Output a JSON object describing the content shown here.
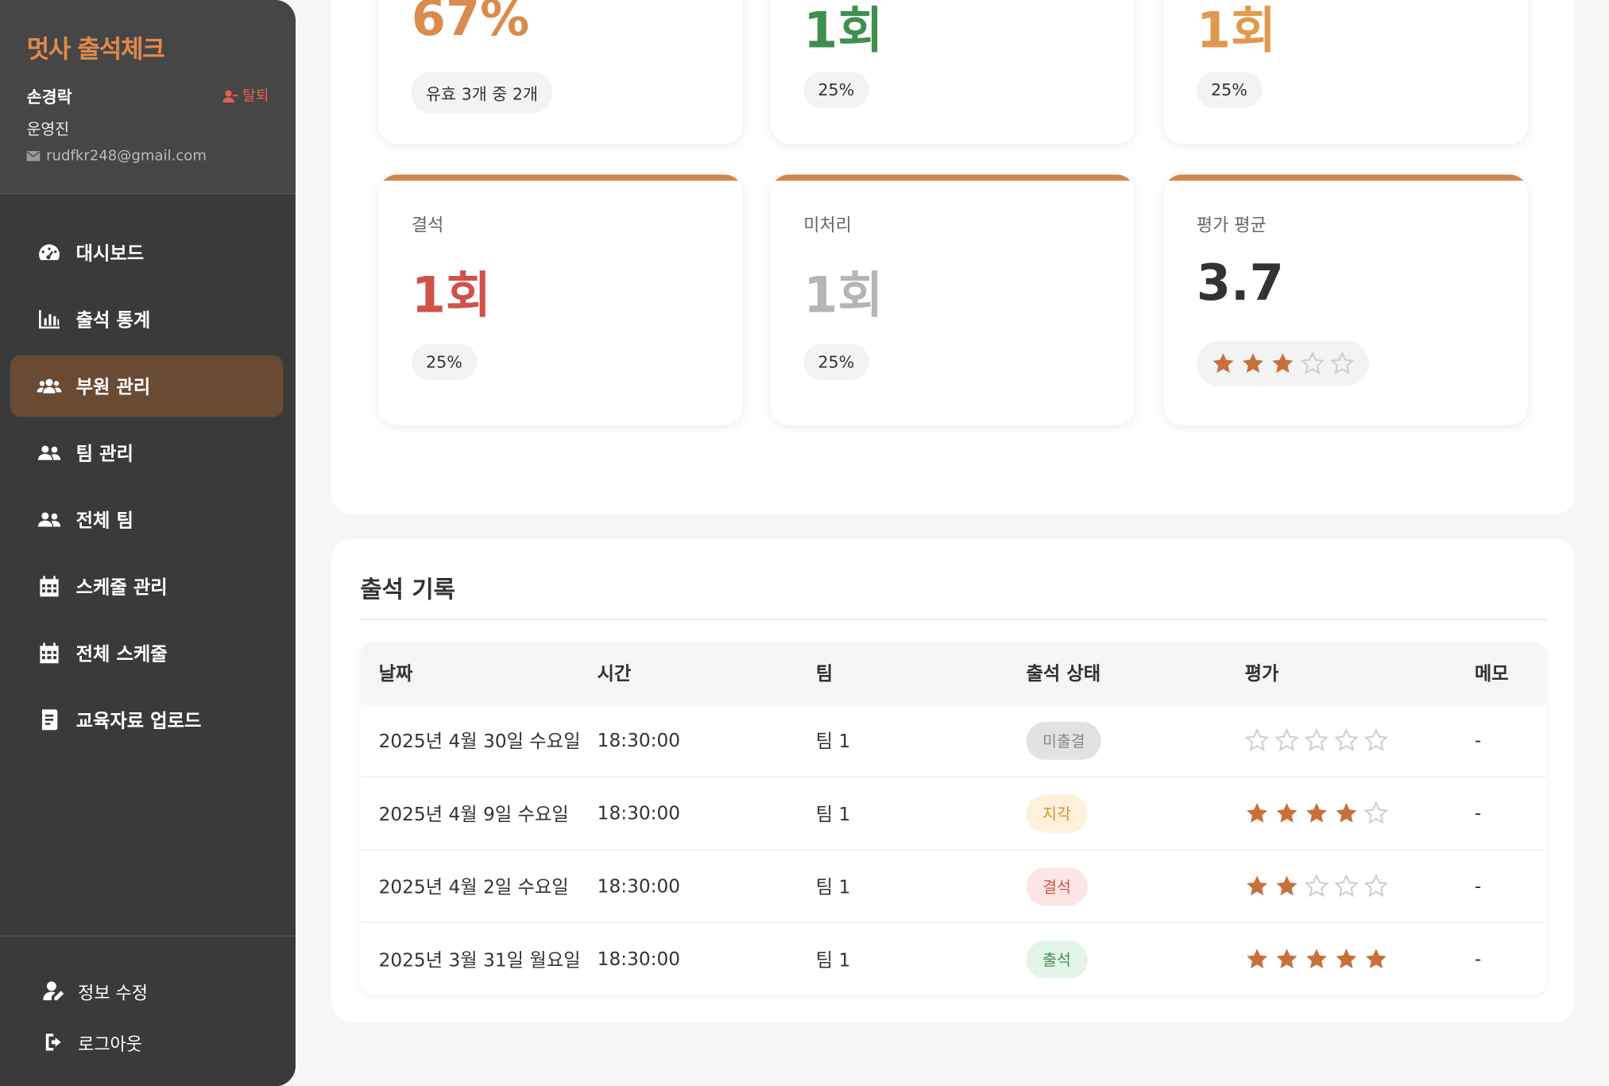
{
  "app": {
    "brand": "멋사 출석체크"
  },
  "user": {
    "name": "손경락",
    "leave": "탈퇴",
    "role": "운영진",
    "email": "rudfkr248@gmail.com"
  },
  "nav": [
    {
      "label": "대시보드",
      "icon": "dashboard-icon",
      "active": false
    },
    {
      "label": "출석 통계",
      "icon": "chart-bar-icon",
      "active": false
    },
    {
      "label": "부원 관리",
      "icon": "users-icon",
      "active": true
    },
    {
      "label": "팀 관리",
      "icon": "user-group-icon",
      "active": false
    },
    {
      "label": "전체 팀",
      "icon": "user-group-icon",
      "active": false
    },
    {
      "label": "스케줄 관리",
      "icon": "calendar-icon",
      "active": false
    },
    {
      "label": "전체 스케줄",
      "icon": "calendar-icon",
      "active": false
    },
    {
      "label": "교육자료 업로드",
      "icon": "book-icon",
      "active": false
    }
  ],
  "bottom": {
    "edit": "정보 수정",
    "logout": "로그아웃"
  },
  "stats_top": [
    {
      "value": "67%",
      "chip": "유효 3개 중 2개",
      "color": "#d98c4b"
    },
    {
      "value": "1회",
      "chip": "25%",
      "color": "#3f8f4e"
    },
    {
      "value": "1회",
      "chip": "25%",
      "color": "#e09a4f"
    }
  ],
  "stats": [
    {
      "label": "결석",
      "value": "1회",
      "chip": "25%",
      "color": "#d0524a"
    },
    {
      "label": "미처리",
      "value": "1회",
      "chip": "25%",
      "color": "#b5b5b5"
    },
    {
      "label": "평가 평균",
      "value": "3.7",
      "rating": 3,
      "color": "#333333"
    }
  ],
  "records": {
    "title": "출석 기록",
    "columns": [
      "날짜",
      "시간",
      "팀",
      "출석 상태",
      "평가",
      "메모"
    ],
    "rows": [
      {
        "date": "2025년 4월 30일 수요일",
        "time": "18:30:00",
        "team": "팀 1",
        "status": "미출결",
        "rating": 0,
        "memo": "-",
        "status_bg": "#e2e2e2",
        "status_fg": "#888888"
      },
      {
        "date": "2025년 4월 9일 수요일",
        "time": "18:30:00",
        "team": "팀 1",
        "status": "지각",
        "rating": 4,
        "memo": "-",
        "status_bg": "#fdf1dc",
        "status_fg": "#d8902f"
      },
      {
        "date": "2025년 4월 2일 수요일",
        "time": "18:30:00",
        "team": "팀 1",
        "status": "결석",
        "rating": 2,
        "memo": "-",
        "status_bg": "#fbe5e5",
        "status_fg": "#d0524a"
      },
      {
        "date": "2025년 3월 31일 월요일",
        "time": "18:30:00",
        "team": "팀 1",
        "status": "출석",
        "rating": 5,
        "memo": "-",
        "status_bg": "#e3f5e6",
        "status_fg": "#3f8f4e"
      }
    ]
  },
  "colors": {
    "accent": "#d1874f",
    "star_filled": "#c8703a",
    "star_empty": "#cfcfcf"
  }
}
